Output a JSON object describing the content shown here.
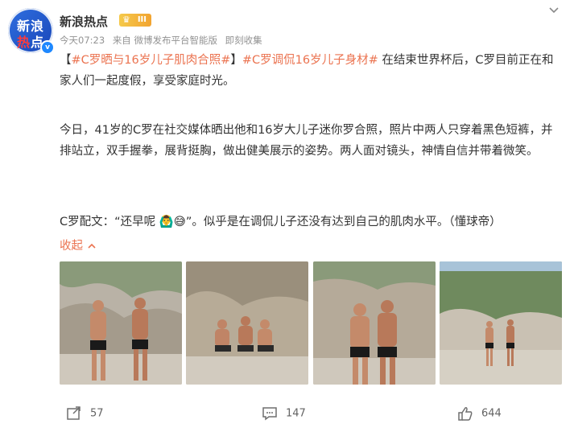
{
  "header": {
    "avatar_line1": "新浪",
    "avatar_line2a": "热",
    "avatar_line2b": "点",
    "verified_mark": "v",
    "account_name": "新浪热点",
    "level_badge": "III",
    "time": "今天07:23",
    "source": "来自 微博发布平台智能版",
    "edited": "即刻收集",
    "more_icon": "chevron-down-icon"
  },
  "post": {
    "para1": {
      "bracket_open": "【",
      "topic1": "#C罗晒与16岁儿子肌肉合照#",
      "bracket_close": "】",
      "topic2": "#C罗调侃16岁儿子身材#",
      "text": " 在结束世界杯后，C罗目前正在和家人们一起度假，享受家庭时光。"
    },
    "para2": "今日，41岁的C罗在社交媒体晒出他和16岁大儿子迷你罗合照，照片中两人只穿着黑色短裤，并排站立，双手握拳，展背挺胸，做出健美展示的姿势。两人面对镜头，神情自信并带着微笑。",
    "para3": "C罗配文：“还早呢 🙆‍♂️😅”。似乎是在调侃儿子还没有达到自己的肌肉水平。（懂球帝）",
    "collapse_label": "收起"
  },
  "images": [
    {
      "name": "photo-1"
    },
    {
      "name": "photo-2"
    },
    {
      "name": "photo-3"
    },
    {
      "name": "photo-4"
    }
  ],
  "footer": {
    "repost_count": "57",
    "comment_count": "147",
    "like_count": "644"
  },
  "colors": {
    "topic": "#eb7350",
    "meta_text": "#939393",
    "avatar_blue": "#1946b8",
    "badge_gold": "#f2a431"
  }
}
